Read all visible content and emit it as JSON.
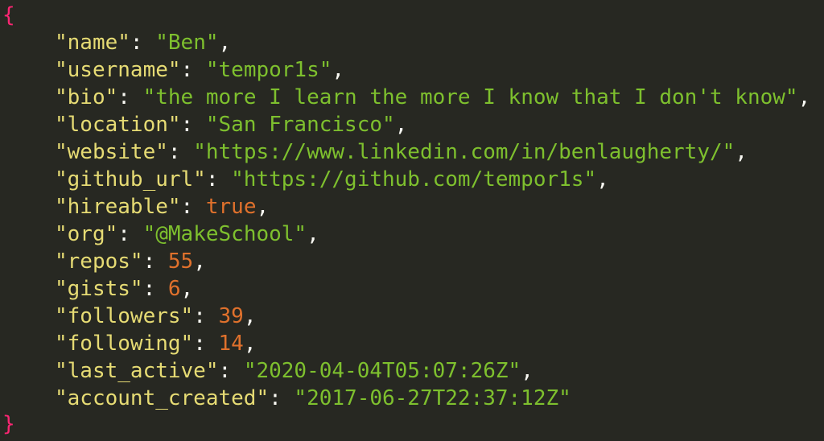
{
  "open_brace": "{",
  "close_brace": "}",
  "entries": [
    {
      "key": "\"name\"",
      "value": "\"Ben\"",
      "type": "str",
      "comma": ","
    },
    {
      "key": "\"username\"",
      "value": "\"tempor1s\"",
      "type": "str",
      "comma": ","
    },
    {
      "key": "\"bio\"",
      "value": "\"the more I learn the more I know that I don't know\"",
      "type": "str",
      "comma": ","
    },
    {
      "key": "\"location\"",
      "value": "\"San Francisco\"",
      "type": "str",
      "comma": ","
    },
    {
      "key": "\"website\"",
      "value": "\"https://www.linkedin.com/in/benlaugherty/\"",
      "type": "str",
      "comma": ","
    },
    {
      "key": "\"github_url\"",
      "value": "\"https://github.com/tempor1s\"",
      "type": "str",
      "comma": ","
    },
    {
      "key": "\"hireable\"",
      "value": "true",
      "type": "num",
      "comma": ","
    },
    {
      "key": "\"org\"",
      "value": "\"@MakeSchool\"",
      "type": "str",
      "comma": ","
    },
    {
      "key": "\"repos\"",
      "value": "55",
      "type": "num",
      "comma": ","
    },
    {
      "key": "\"gists\"",
      "value": "6",
      "type": "num",
      "comma": ","
    },
    {
      "key": "\"followers\"",
      "value": "39",
      "type": "num",
      "comma": ","
    },
    {
      "key": "\"following\"",
      "value": "14",
      "type": "num",
      "comma": ","
    },
    {
      "key": "\"last_active\"",
      "value": "\"2020-04-04T05:07:26Z\"",
      "type": "str",
      "comma": ","
    },
    {
      "key": "\"account_created\"",
      "value": "\"2017-06-27T22:37:12Z\"",
      "type": "str",
      "comma": ""
    }
  ],
  "colors": {
    "background": "#272822",
    "brace": "#f92672",
    "key": "#e6db74",
    "string": "#7ec02e",
    "number": "#e0712c",
    "punctuation": "#f8f8f2"
  }
}
